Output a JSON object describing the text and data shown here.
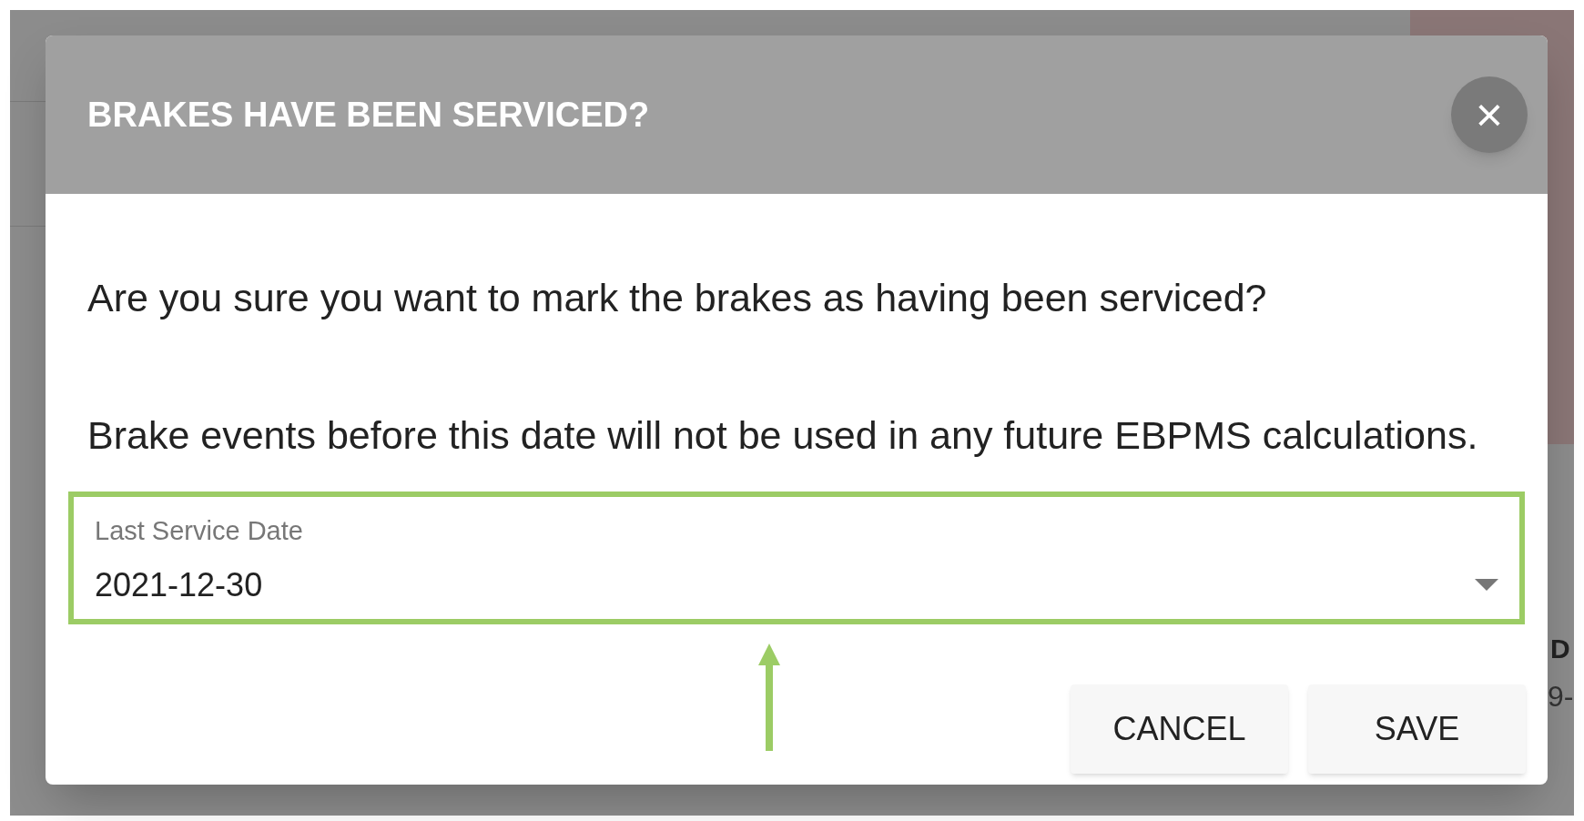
{
  "background": {
    "texts": [
      "D",
      "9-"
    ]
  },
  "dialog": {
    "title": "BRAKES HAVE BEEN SERVICED?",
    "close": "×",
    "paragraphs": [
      "Are you sure you want to mark the brakes as having been serviced?",
      "Brake events before this date will not be used in any future EBPMS calculations."
    ],
    "field": {
      "label": "Last Service Date",
      "value": "2021-12-30",
      "highlighted": true
    },
    "buttons": [
      "CANCEL",
      "SAVE"
    ]
  }
}
